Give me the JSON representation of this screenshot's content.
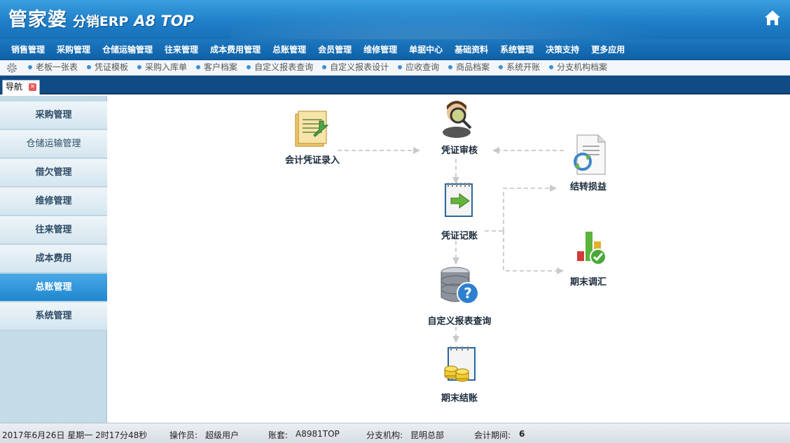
{
  "header": {
    "logo_main": "管家婆",
    "logo_sub": "分销ERP",
    "logo_ver": "A8 TOP"
  },
  "main_menu": [
    "销售管理",
    "采购管理",
    "仓储运输管理",
    "往来管理",
    "成本费用管理",
    "总账管理",
    "会员管理",
    "维修管理",
    "单据中心",
    "基础资料",
    "系统管理",
    "决策支持",
    "更多应用"
  ],
  "quick_links": [
    "老板一张表",
    "凭证模板",
    "采购入库单",
    "客户档案",
    "自定义报表查询",
    "自定义报表设计",
    "应收查询",
    "商品档案",
    "系统开账",
    "分支机构档案"
  ],
  "tab": {
    "label": "导航"
  },
  "sidebar": [
    {
      "label": "采购管理"
    },
    {
      "label": "仓储运输管理"
    },
    {
      "label": "借欠管理"
    },
    {
      "label": "维修管理"
    },
    {
      "label": "往来管理"
    },
    {
      "label": "成本费用"
    },
    {
      "label": "总账管理",
      "active": true
    },
    {
      "label": "系统管理"
    }
  ],
  "flow": {
    "voucher_entry": "会计凭证录入",
    "voucher_audit": "凭证审核",
    "transfer_profit": "结转损益",
    "voucher_posting": "凭证记账",
    "period_adjust": "期末调汇",
    "custom_report_query": "自定义报表查询",
    "period_close": "期末结账"
  },
  "status": {
    "datetime": "2017年6月26日  星期一  2时17分48秒",
    "operator_label": "操作员:",
    "operator": "超级用户",
    "account_label": "账套:",
    "account": "A8981TOP",
    "branch_label": "分支机构:",
    "branch": "昆明总部",
    "period_label": "会计期间:",
    "period": "6"
  },
  "colors": {
    "header_blue": "#1f7fc8",
    "menu_blue": "#0f60a6",
    "tab_strip": "#114b85",
    "sidebar_active": "#1f86cf"
  }
}
